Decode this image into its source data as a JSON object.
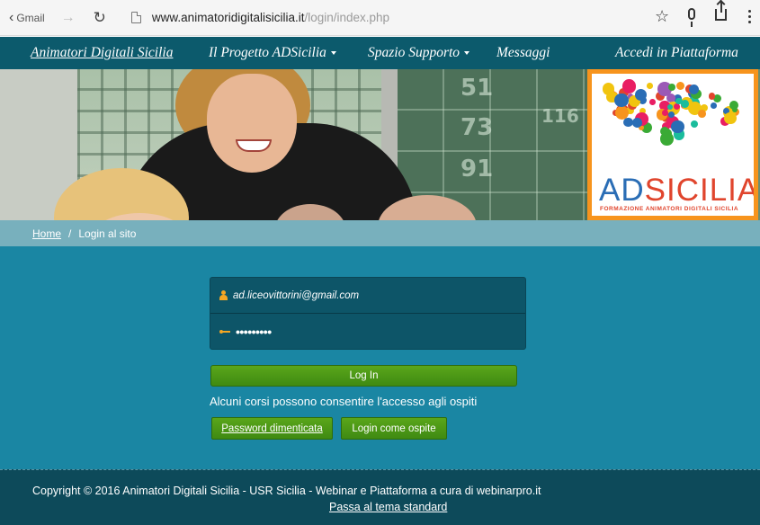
{
  "browser": {
    "back_label": "Gmail",
    "url_host": "www.animatoridigitalisicilia.it",
    "url_path": "/login/index.php"
  },
  "navbar": {
    "brand": "Animatori Digitali Sicilia",
    "items": [
      {
        "label": "Il Progetto ADSicilia",
        "has_dropdown": true
      },
      {
        "label": "Spazio Supporto",
        "has_dropdown": true
      },
      {
        "label": "Messaggi",
        "has_dropdown": false
      },
      {
        "label": "Accedi in Piattaforma",
        "has_dropdown": false
      }
    ]
  },
  "banner": {
    "chalk": [
      "51",
      "116",
      "73",
      "91"
    ],
    "logo": {
      "name_blue": "AD",
      "name_red": "SICILIA",
      "tagline": "FORMAZIONE ANIMATORI DIGITALI SICILIA"
    }
  },
  "breadcrumb": {
    "home": "Home",
    "separator": "/",
    "current": "Login al sito"
  },
  "login": {
    "username_value": "ad.liceovittorini@gmail.com",
    "password_value": "•••••••••",
    "login_button": "Log In",
    "guest_notice": "Alcuni corsi possono consentire l'accesso agli ospiti",
    "forgot_button": "Password dimenticata",
    "guest_button": "Login come ospite"
  },
  "footer": {
    "copyright": "Copyright © 2016 Animatori Digitali Sicilia - USR Sicilia - Webinar e Piattaforma a cura di webinarpro.it",
    "theme_link": "Passa al tema standard"
  },
  "colors": {
    "navbar_bg": "#0c5a6c",
    "main_bg": "#1a86a3",
    "breadcrumb_bg": "#78b0bd",
    "button_green": "#4a9a16",
    "footer_bg": "#0d4a5a",
    "logo_orange": "#f7941d"
  }
}
